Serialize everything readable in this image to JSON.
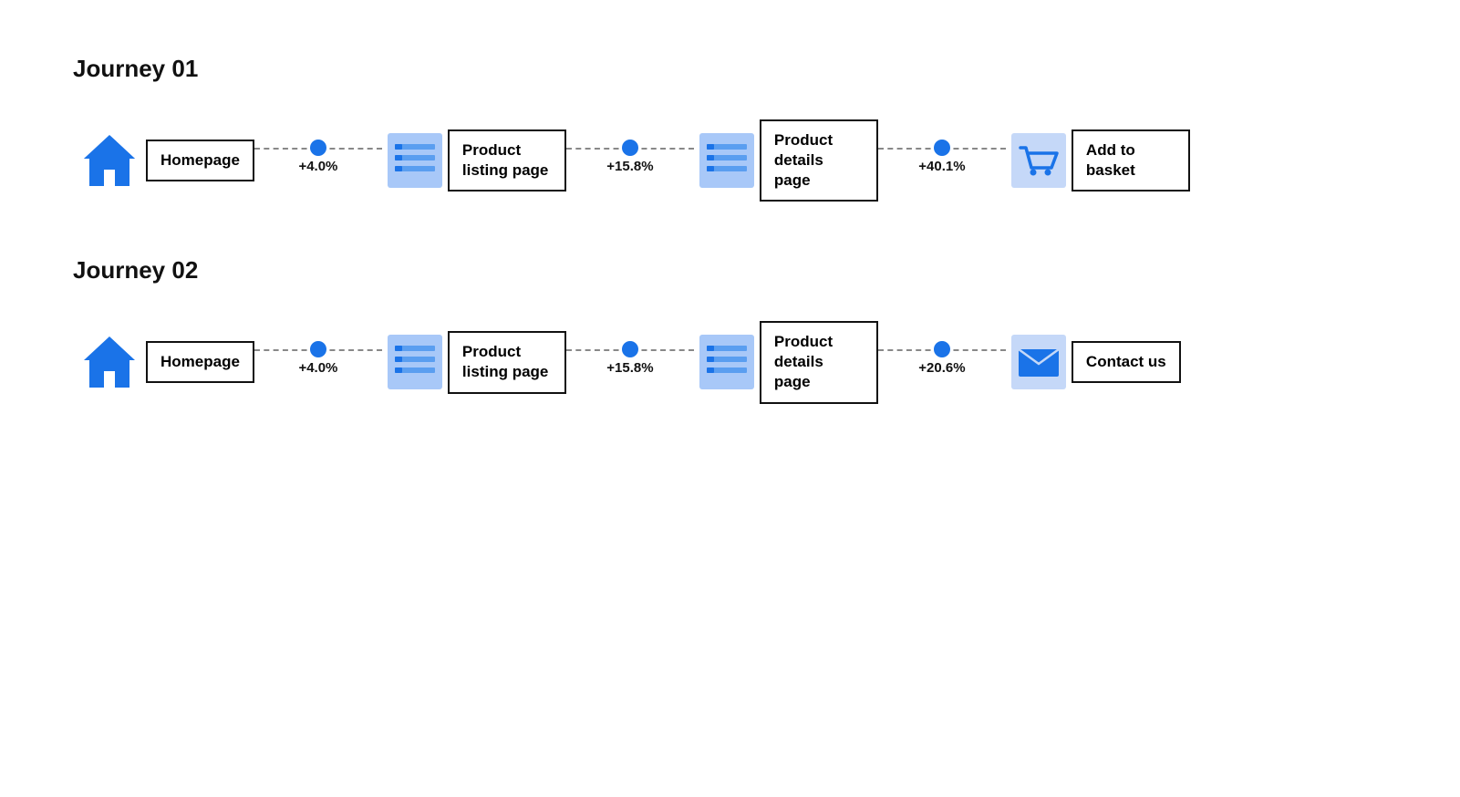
{
  "journeys": [
    {
      "id": "journey-01",
      "title": "Journey 01",
      "nodes": [
        {
          "id": "homepage-1",
          "label": "Homepage",
          "icon": "home"
        },
        {
          "id": "plp-1",
          "label": "Product listing page",
          "icon": "list"
        },
        {
          "id": "pdp-1",
          "label": "Product details page",
          "icon": "list"
        },
        {
          "id": "basket-1",
          "label": "Add to basket",
          "icon": "cart"
        }
      ],
      "connectors": [
        {
          "id": "c1-1",
          "percent": "+4.0%"
        },
        {
          "id": "c1-2",
          "percent": "+15.8%"
        },
        {
          "id": "c1-3",
          "percent": "+40.1%"
        }
      ]
    },
    {
      "id": "journey-02",
      "title": "Journey 02",
      "nodes": [
        {
          "id": "homepage-2",
          "label": "Homepage",
          "icon": "home"
        },
        {
          "id": "plp-2",
          "label": "Product listing page",
          "icon": "list"
        },
        {
          "id": "pdp-2",
          "label": "Product details page",
          "icon": "list"
        },
        {
          "id": "contact-2",
          "label": "Contact us",
          "icon": "mail"
        }
      ],
      "connectors": [
        {
          "id": "c2-1",
          "percent": "+4.0%"
        },
        {
          "id": "c2-2",
          "percent": "+15.8%"
        },
        {
          "id": "c2-3",
          "percent": "+20.6%"
        }
      ]
    }
  ]
}
